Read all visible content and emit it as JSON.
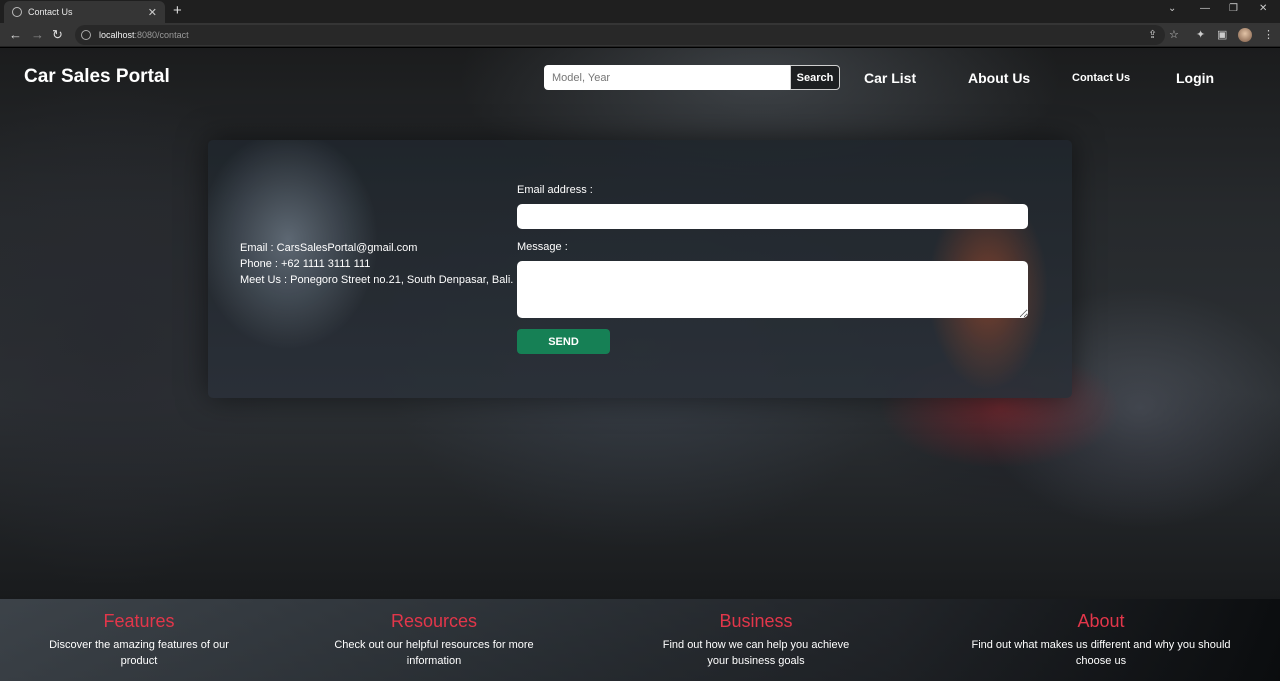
{
  "browser": {
    "tab_title": "Contact Us",
    "url_host": "localhost",
    "url_path": ":8080/contact"
  },
  "header": {
    "brand": "Car Sales Portal",
    "search_placeholder": "Model, Year",
    "search_button": "Search",
    "nav": {
      "car_list": "Car List",
      "about_us": "About Us",
      "contact_us": "Contact Us",
      "login": "Login"
    }
  },
  "contact": {
    "email_line": "Email : CarsSalesPortal@gmail.com",
    "phone_line": "Phone : +62 1111 3111 111",
    "address_line": "Meet Us : Ponegoro Street no.21, South Denpasar, Bali.",
    "form": {
      "email_label": "Email address :",
      "message_label": "Message :",
      "send_label": "SEND"
    }
  },
  "footer": {
    "columns": [
      {
        "title": "Features",
        "text": "Discover the amazing features of our product"
      },
      {
        "title": "Resources",
        "text": "Check out our helpful resources for more information"
      },
      {
        "title": "Business",
        "text": "Find out how we can help you achieve your business goals"
      },
      {
        "title": "About",
        "text": "Find out what makes us different and why you should choose us"
      }
    ]
  },
  "colors": {
    "accent_red": "#e2364a",
    "send_green": "#168055"
  },
  "icons": [
    "globe-icon",
    "close-icon",
    "plus-icon",
    "back-icon",
    "forward-icon",
    "reload-icon",
    "info-icon",
    "share-icon",
    "star-icon",
    "extensions-icon",
    "sidepanel-icon",
    "menu-icon"
  ]
}
